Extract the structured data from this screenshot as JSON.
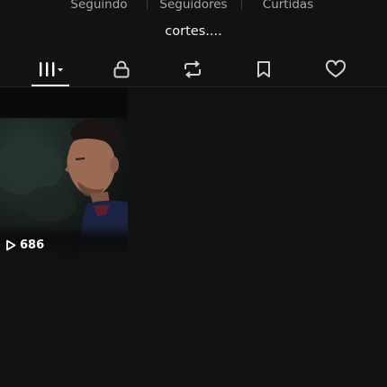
{
  "profile": {
    "stats": [
      {
        "label": "Seguindo"
      },
      {
        "label": "Seguidores"
      },
      {
        "label": "Curtidas"
      }
    ],
    "bio": "cortes...."
  },
  "tabs": [
    {
      "name": "videos",
      "icon": "grid-bars-icon",
      "active": true
    },
    {
      "name": "private",
      "icon": "lock-icon",
      "active": false
    },
    {
      "name": "reposts",
      "icon": "repost-icon",
      "active": false
    },
    {
      "name": "favorites",
      "icon": "bookmark-icon",
      "active": false
    },
    {
      "name": "liked",
      "icon": "heart-icon",
      "active": false
    }
  ],
  "videos": [
    {
      "views": "686",
      "icon": "play-outline-icon"
    }
  ],
  "colors": {
    "background": "#121212",
    "text_primary": "#ffffff",
    "text_secondary": "#a8a8a8"
  }
}
